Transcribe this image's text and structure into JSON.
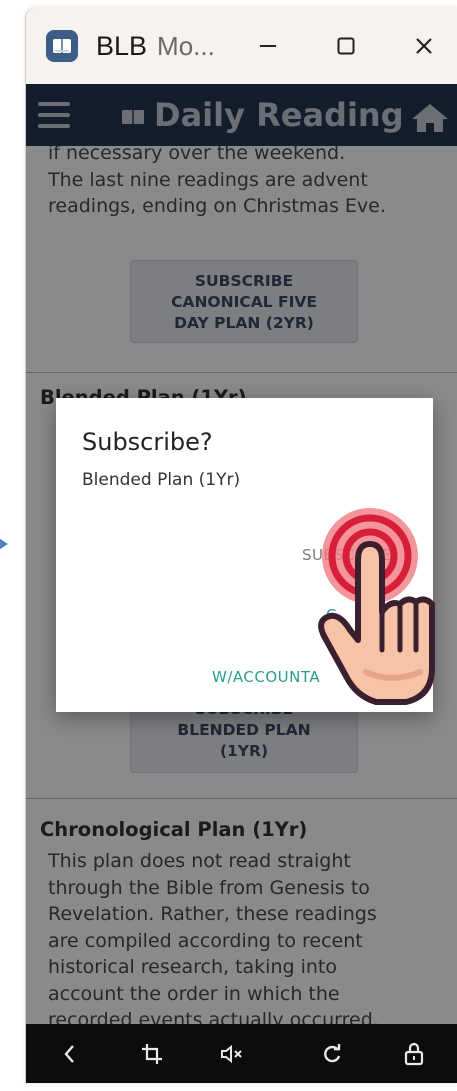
{
  "window": {
    "app_short": "BLB",
    "title_rest": "Mo...",
    "minimize_icon": "minimize-icon",
    "maximize_icon": "maximize-icon",
    "close_icon": "close-icon"
  },
  "header": {
    "title": "Daily Reading",
    "menu_icon": "hamburger-menu-icon",
    "book_icon": "book-icon",
    "home_icon": "home-icon"
  },
  "content": {
    "prev_plan_text": [
      "if necessary over the weekend.",
      "The last nine readings are advent",
      "readings, ending on Christmas Eve."
    ],
    "prev_plan_button": [
      "SUBSCRIBE",
      "CANONICAL FIVE",
      "DAY PLAN (2YR)"
    ],
    "blended_title": "Blended Plan (1Yr)",
    "blended_button": [
      "SUBSCRIBE",
      "BLENDED PLAN",
      "(1YR)"
    ],
    "chrono_title": "Chronological Plan (1Yr)",
    "chrono_text": [
      "This plan does not read straight",
      "through the Bible from Genesis to",
      "Revelation. Rather, these readings",
      "are compiled according to recent",
      "historical research, taking into",
      "account the order in which the",
      "recorded events actually occurred."
    ]
  },
  "dialog": {
    "title": "Subscribe?",
    "message": "Blended Plan (1Yr)",
    "action_subscribe": "SUBSCRIBE",
    "action_second": "C",
    "action_accountability": "W/ACCOUNTA"
  },
  "nav": {
    "back_icon": "back-icon",
    "crop_icon": "crop-rotate-icon",
    "mute_icon": "volume-mute-icon",
    "refresh_icon": "refresh-icon",
    "lock_icon": "lock-icon"
  },
  "colors": {
    "appbar": "#263752",
    "accent_teal": "#2a9d8f",
    "touch_ring": "#e0384a"
  }
}
